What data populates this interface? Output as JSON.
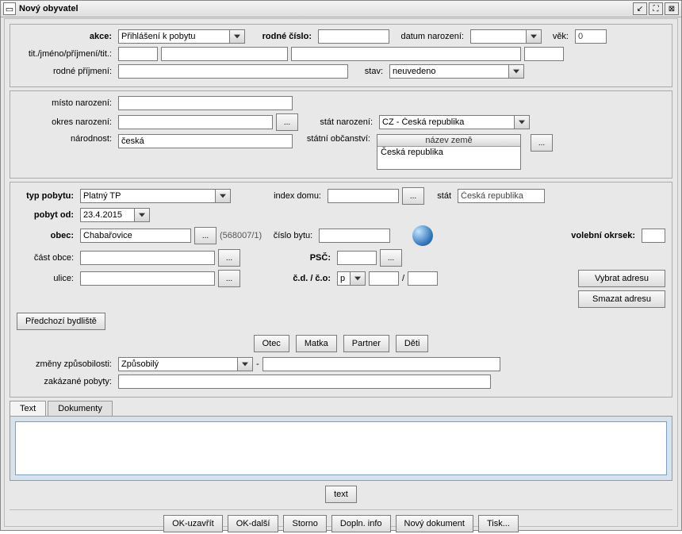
{
  "window": {
    "title": "Nový obyvatel"
  },
  "sec1": {
    "akce_label": "akce:",
    "akce_value": "Přihlášení k pobytu",
    "rc_label": "rodné číslo:",
    "rc_value": "",
    "dn_label": "datum narození:",
    "dn_value": "",
    "vek_label": "věk:",
    "vek_value": "0",
    "name_label": "tit./jméno/příjmení/tit.:",
    "t1": "",
    "t2": "",
    "t3": "",
    "t4": "",
    "rp_label": "rodné příjmení:",
    "rp_value": "",
    "stav_label": "stav:",
    "stav_value": "neuvedeno"
  },
  "sec2": {
    "mn_label": "místo narození:",
    "mn_value": "",
    "on_label": "okres narození:",
    "on_value": "",
    "sn_label": "stát narození:",
    "sn_value": "CZ - Česká republika",
    "nar_label": "národnost:",
    "nar_value": "česká",
    "so_label": "státní občanství:",
    "so_header": "název země",
    "so_item": "Česká republika"
  },
  "sec3": {
    "tp_label": "typ pobytu:",
    "tp_value": "Platný TP",
    "id_label": "index domu:",
    "id_value": "",
    "stat_label": "stát",
    "stat_value": "Česká republika",
    "po_label": "pobyt od:",
    "po_value": "23.4.2015",
    "obec_label": "obec:",
    "obec_value": "Chabařovice",
    "obec_code": "(568007/1)",
    "cb_label": "číslo bytu:",
    "cb_value": "",
    "vo_label": "volební okrsek:",
    "vo_value": "",
    "co_label": "část obce:",
    "co_value": "",
    "psc_label": "PSČ:",
    "psc_value": "",
    "ul_label": "ulice:",
    "ul_value": "",
    "cdco_label": "č.d. / č.o:",
    "cdco_type": "p",
    "cdco_v1": "",
    "cdco_v2": "",
    "vybrat": "Vybrat adresu",
    "smazat": "Smazat adresu",
    "prev": "Předchozí bydliště",
    "otec": "Otec",
    "matka": "Matka",
    "partner": "Partner",
    "deti": "Děti"
  },
  "sec4": {
    "zz_label": "změny způsobilosti:",
    "zz_value": "Způsobilý",
    "zz_desc": "",
    "zp_label": "zakázané pobyty:",
    "zp_value": ""
  },
  "tabs": {
    "text": "Text",
    "dok": "Dokumenty",
    "textbtn": "text"
  },
  "footer": {
    "ok_close": "OK-uzavřít",
    "ok_next": "OK-další",
    "storno": "Storno",
    "dopln": "Dopln. info",
    "novy": "Nový dokument",
    "tisk": "Tisk..."
  },
  "ellipsis": "..."
}
